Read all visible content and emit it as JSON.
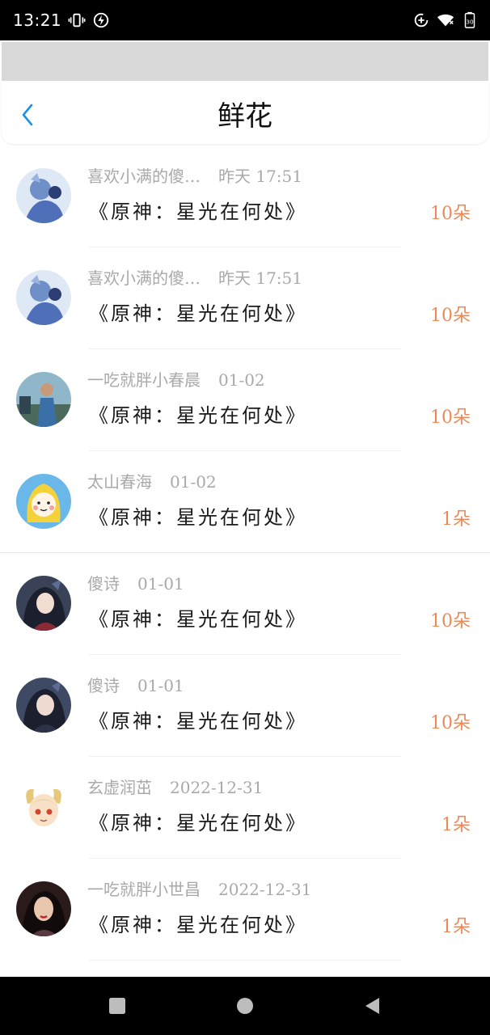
{
  "status_bar": {
    "time": "13:21",
    "battery_level": "30",
    "icons": [
      "vibrate-icon",
      "charging-icon",
      "data-saver-icon",
      "wifi-icon",
      "battery-icon"
    ]
  },
  "header": {
    "title": "鲜花",
    "back_icon": "chevron-left-icon",
    "accent_color": "#1e90e8"
  },
  "colors": {
    "count": "#e88a5a",
    "meta": "#a9a9a9",
    "title": "#1a1a1a"
  },
  "records": [
    {
      "user": "喜欢小满的傻…",
      "time": "昨天 17:51",
      "work": "《原神：星光在何处》",
      "count": "10朵",
      "avatar": "anime-blue-avatar"
    },
    {
      "user": "喜欢小满的傻…",
      "time": "昨天 17:51",
      "work": "《原神：星光在何处》",
      "count": "10朵",
      "avatar": "anime-blue-avatar"
    },
    {
      "user": "一吃就胖小春晨",
      "time": "01-02",
      "work": "《原神：星光在何处》",
      "count": "10朵",
      "avatar": "photo-outdoor-avatar"
    },
    {
      "user": "太山春海",
      "time": "01-02",
      "work": "《原神：星光在何处》",
      "count": "1朵",
      "avatar": "yellow-cartoon-avatar"
    },
    {
      "user": "傻诗",
      "time": "01-01",
      "work": "《原神：星光在何处》",
      "count": "10朵",
      "avatar": "anime-dark-avatar"
    },
    {
      "user": "傻诗",
      "time": "01-01",
      "work": "《原神：星光在何处》",
      "count": "10朵",
      "avatar": "anime-dark-avatar"
    },
    {
      "user": "玄虚润茁",
      "time": "2022-12-31",
      "work": "《原神：星光在何处》",
      "count": "1朵",
      "avatar": "chibi-horns-avatar"
    },
    {
      "user": "一吃就胖小世昌",
      "time": "2022-12-31",
      "work": "《原神：星光在何处》",
      "count": "1朵",
      "avatar": "photo-portrait-avatar"
    }
  ],
  "nav_bar": {
    "buttons": [
      "recents-square-icon",
      "home-circle-icon",
      "back-triangle-icon"
    ]
  }
}
